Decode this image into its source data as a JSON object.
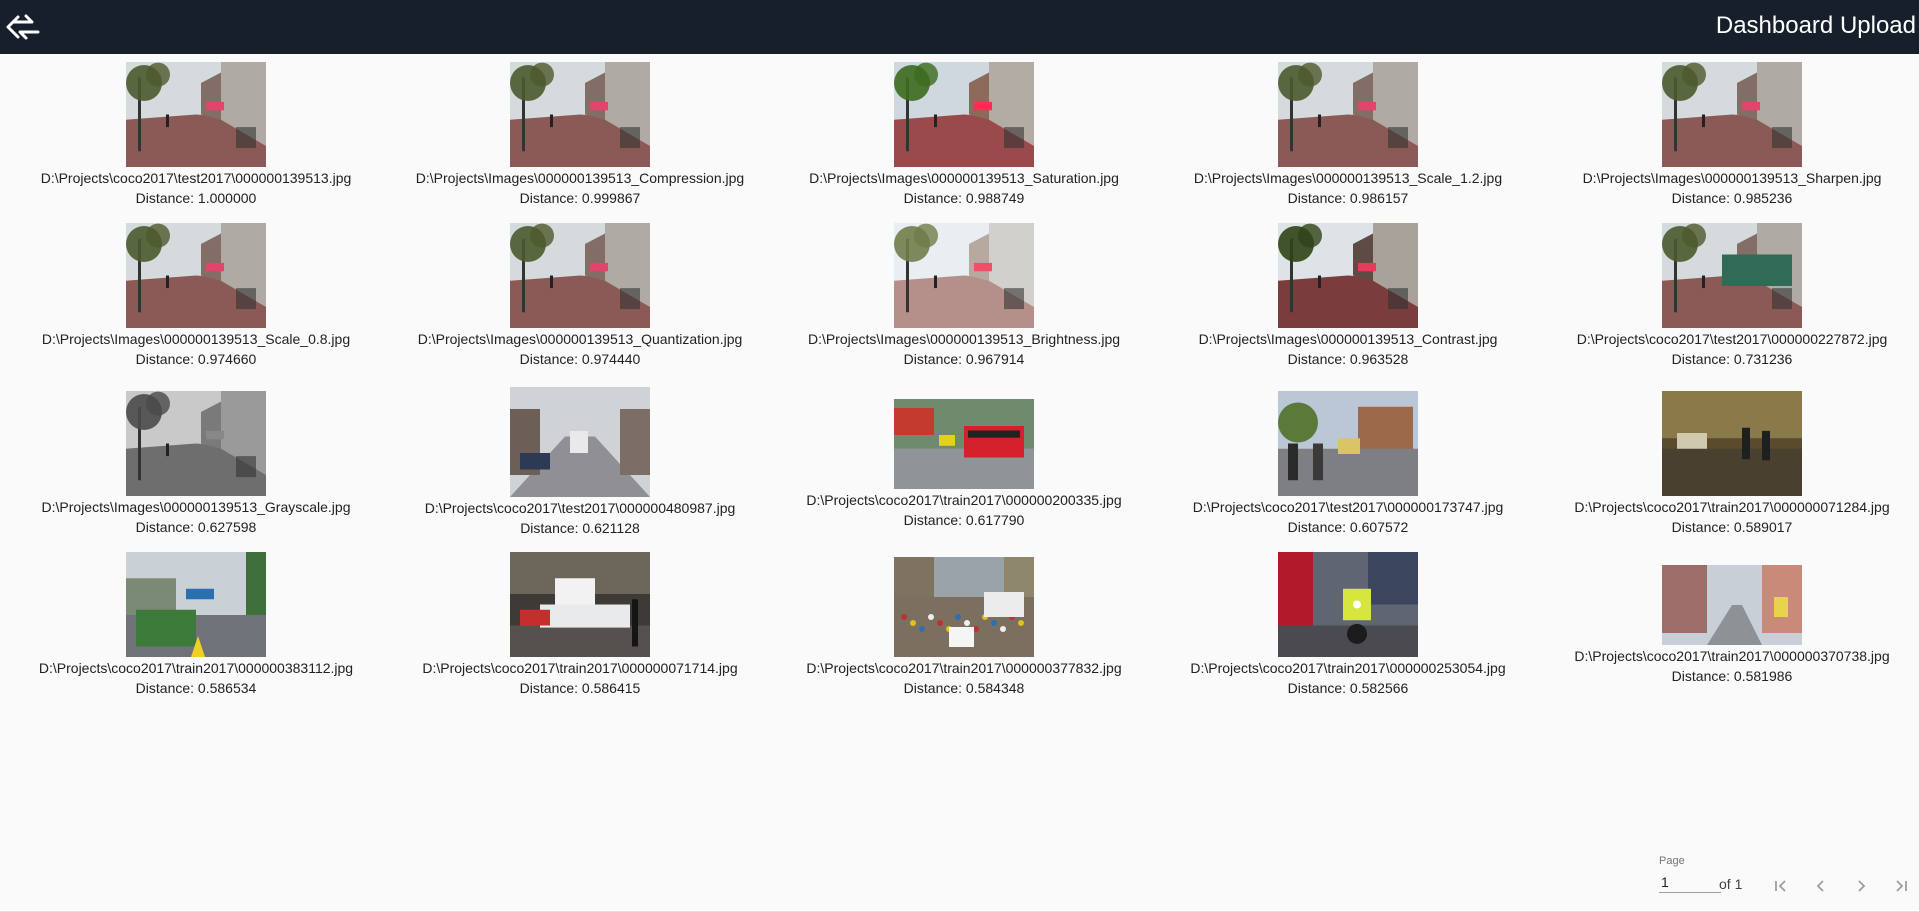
{
  "header": {
    "title": "Dashboard Upload",
    "logo_icon": "sync-arrows-logo-icon",
    "background": "#17202a"
  },
  "results": [
    {
      "path": "D:\\Projects\\coco2017\\test2017\\000000139513.jpg",
      "distance": "Distance: 1.000000",
      "scene": "street",
      "tone": "color"
    },
    {
      "path": "D:\\Projects\\Images\\000000139513_Compression.jpg",
      "distance": "Distance: 0.999867",
      "scene": "street",
      "tone": "color"
    },
    {
      "path": "D:\\Projects\\Images\\000000139513_Saturation.jpg",
      "distance": "Distance: 0.988749",
      "scene": "street",
      "tone": "saturated"
    },
    {
      "path": "D:\\Projects\\Images\\000000139513_Scale_1.2.jpg",
      "distance": "Distance: 0.986157",
      "scene": "street",
      "tone": "color"
    },
    {
      "path": "D:\\Projects\\Images\\000000139513_Sharpen.jpg",
      "distance": "Distance: 0.985236",
      "scene": "street",
      "tone": "color"
    },
    {
      "path": "D:\\Projects\\Images\\000000139513_Scale_0.8.jpg",
      "distance": "Distance: 0.974660",
      "scene": "street",
      "tone": "color"
    },
    {
      "path": "D:\\Projects\\Images\\000000139513_Quantization.jpg",
      "distance": "Distance: 0.974440",
      "scene": "street",
      "tone": "color"
    },
    {
      "path": "D:\\Projects\\Images\\000000139513_Brightness.jpg",
      "distance": "Distance: 0.967914",
      "scene": "street",
      "tone": "bright"
    },
    {
      "path": "D:\\Projects\\Images\\000000139513_Contrast.jpg",
      "distance": "Distance: 0.963528",
      "scene": "street",
      "tone": "contrast"
    },
    {
      "path": "D:\\Projects\\coco2017\\test2017\\000000227872.jpg",
      "distance": "Distance: 0.731236",
      "scene": "street-bus",
      "tone": "color"
    },
    {
      "path": "D:\\Projects\\Images\\000000139513_Grayscale.jpg",
      "distance": "Distance: 0.627598",
      "scene": "street",
      "tone": "gray"
    },
    {
      "path": "D:\\Projects\\coco2017\\test2017\\000000480987.jpg",
      "distance": "Distance: 0.621128",
      "scene": "avenue",
      "tone": "color"
    },
    {
      "path": "D:\\Projects\\coco2017\\train2017\\000000200335.jpg",
      "distance": "Distance: 0.617790",
      "scene": "bus-red",
      "tone": "color"
    },
    {
      "path": "D:\\Projects\\coco2017\\test2017\\000000173747.jpg",
      "distance": "Distance: 0.607572",
      "scene": "cyclists",
      "tone": "color"
    },
    {
      "path": "D:\\Projects\\coco2017\\train2017\\000000071284.jpg",
      "distance": "Distance: 0.589017",
      "scene": "plaza",
      "tone": "color"
    },
    {
      "path": "D:\\Projects\\coco2017\\train2017\\000000383112.jpg",
      "distance": "Distance: 0.586534",
      "scene": "green-bus",
      "tone": "color"
    },
    {
      "path": "D:\\Projects\\coco2017\\train2017\\000000071714.jpg",
      "distance": "Distance: 0.586415",
      "scene": "tow-truck",
      "tone": "color"
    },
    {
      "path": "D:\\Projects\\coco2017\\train2017\\000000377832.jpg",
      "distance": "Distance: 0.584348",
      "scene": "crowd",
      "tone": "color"
    },
    {
      "path": "D:\\Projects\\coco2017\\train2017\\000000253054.jpg",
      "distance": "Distance: 0.582566",
      "scene": "motorbike",
      "tone": "color"
    },
    {
      "path": "D:\\Projects\\coco2017\\train2017\\000000370738.jpg",
      "distance": "Distance: 0.581986",
      "scene": "alley",
      "tone": "color"
    }
  ],
  "pagination": {
    "page_label": "Page",
    "page_value": "1",
    "of_label": "of 1",
    "buttons": [
      "first-page-icon",
      "previous-page-icon",
      "next-page-icon",
      "last-page-icon"
    ]
  }
}
